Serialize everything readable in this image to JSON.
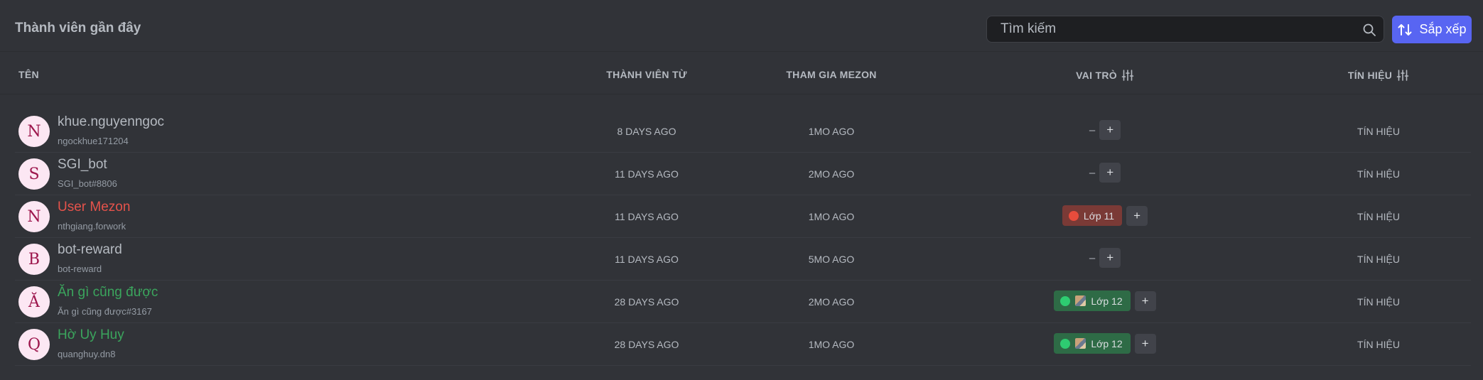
{
  "header": {
    "title": "Thành viên gần đây",
    "search_placeholder": "Tìm kiếm",
    "sort_label": "Sắp xếp"
  },
  "columns": {
    "name": "TÊN",
    "member_since": "THÀNH VIÊN TỪ",
    "joined_mezon": "THAM GIA MEZON",
    "roles": "VAI TRÒ",
    "signal": "TÍN HIỆU"
  },
  "colors": {
    "accent": "#5865f2",
    "role_lop11_bg": "#7a3a36",
    "role_lop11_dot": "#e74c3c",
    "role_lop12_bg": "#2e6b46",
    "role_lop12_dot": "#2ecc71",
    "name_red": "#e5534b",
    "name_green": "#3ba55d"
  },
  "members": [
    {
      "initial": "N",
      "name": "khue.nguyenngoc",
      "handle": "ngockhue171204",
      "member_since": "8 DAYS AGO",
      "joined": "1MO AGO",
      "role": null,
      "signal": "TÍN HIỆU"
    },
    {
      "initial": "S",
      "name": "SGI_bot",
      "handle": "SGI_bot#8806",
      "member_since": "11 DAYS AGO",
      "joined": "2MO AGO",
      "role": null,
      "signal": "TÍN HIỆU"
    },
    {
      "initial": "N",
      "name": "User Mezon",
      "handle": "nthgiang.forwork",
      "member_since": "11 DAYS AGO",
      "joined": "1MO AGO",
      "role": "Lớp 11",
      "signal": "TÍN HIỆU"
    },
    {
      "initial": "B",
      "name": "bot-reward",
      "handle": "bot-reward",
      "member_since": "11 DAYS AGO",
      "joined": "5MO AGO",
      "role": null,
      "signal": "TÍN HIỆU"
    },
    {
      "initial": "Ă",
      "name": "Ăn gì cũng được",
      "handle": "Ăn gì cũng được#3167",
      "member_since": "28 DAYS AGO",
      "joined": "2MO AGO",
      "role": "Lớp 12",
      "signal": "TÍN HIỆU"
    },
    {
      "initial": "Q",
      "name": "Hờ Uy Huy",
      "handle": "quanghuy.dn8",
      "member_since": "28 DAYS AGO",
      "joined": "1MO AGO",
      "role": "Lớp 12",
      "signal": "TÍN HIỆU"
    }
  ],
  "empty_role": "–",
  "add_role": "+"
}
